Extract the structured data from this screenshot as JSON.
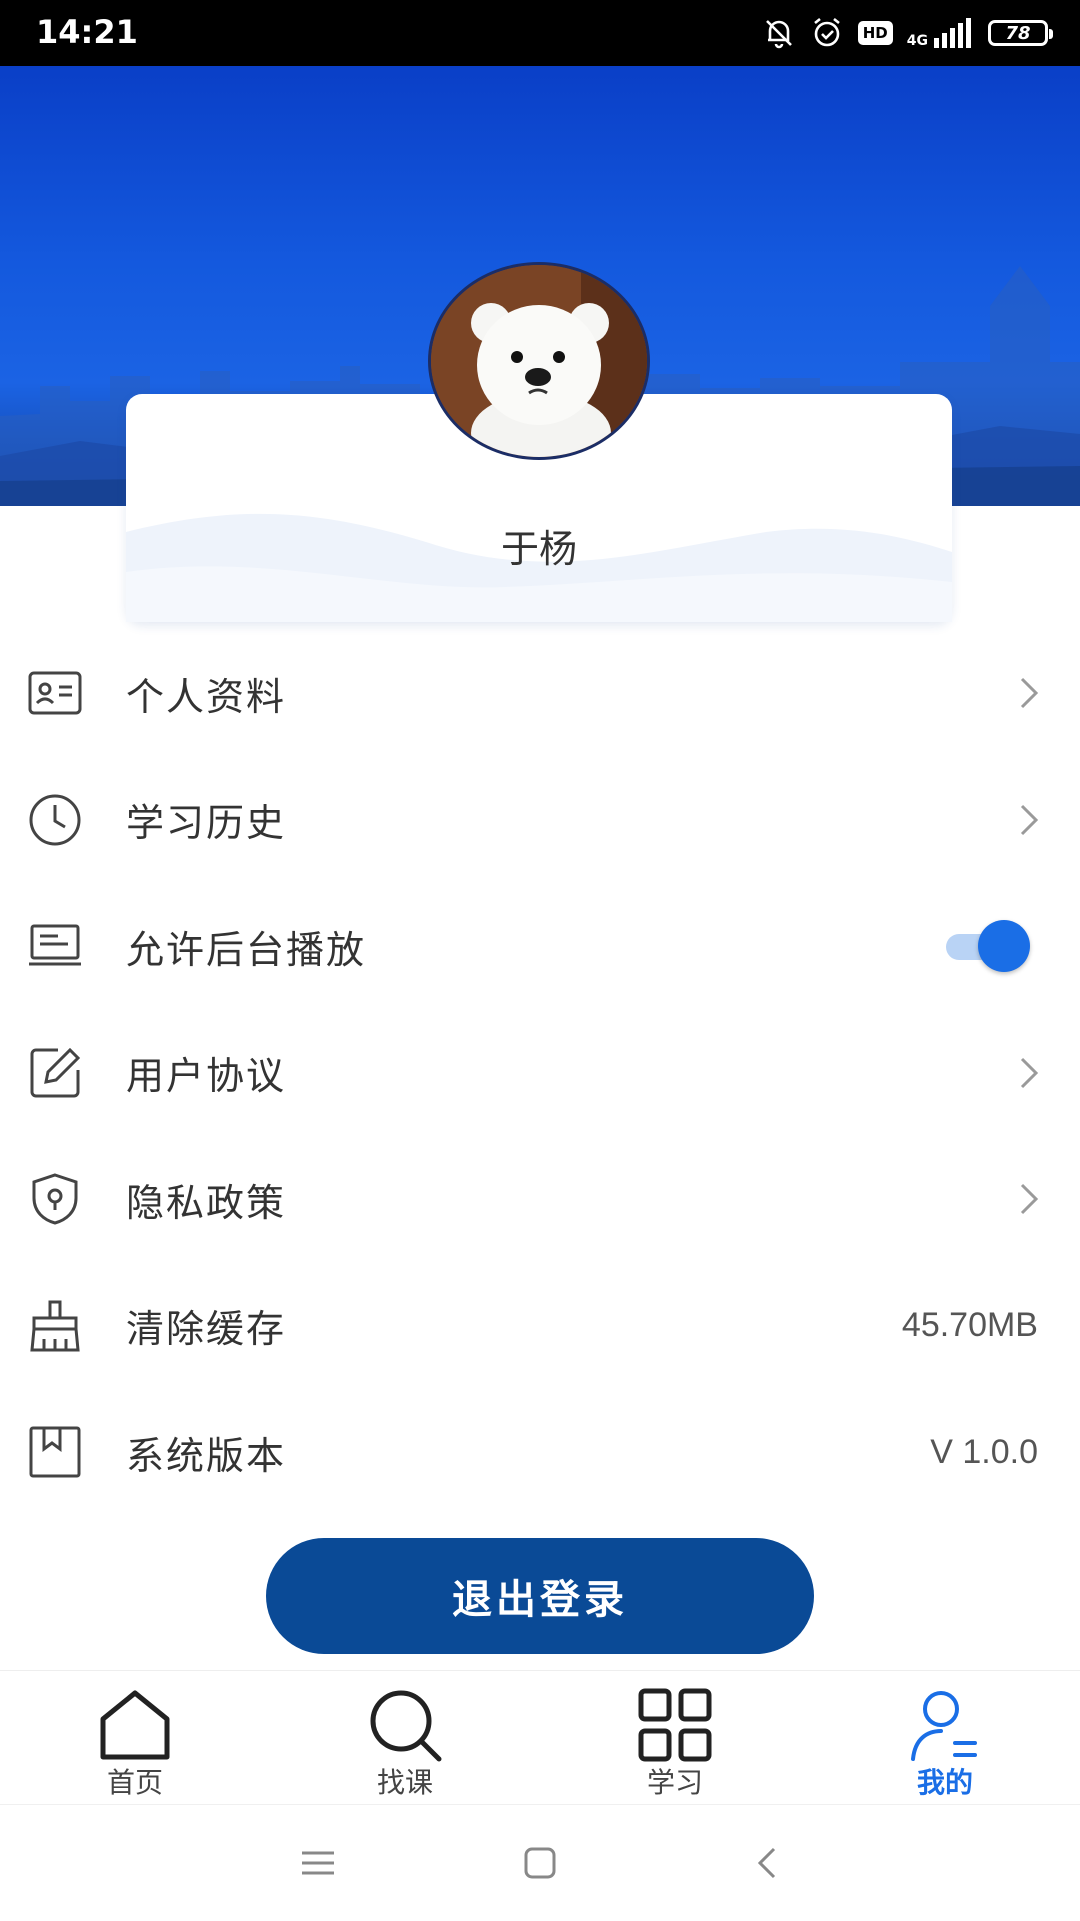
{
  "status_bar": {
    "time": "14:21",
    "network": "4G",
    "hd_label": "HD",
    "battery": "78",
    "icons": [
      "bell-off-icon",
      "alarm-icon",
      "hd-icon",
      "signal-icon",
      "battery-icon"
    ]
  },
  "profile": {
    "name": "于杨",
    "avatar": "avatar-photo"
  },
  "menu": {
    "items": [
      {
        "label": "个人资料",
        "icon": "id-card-icon",
        "accessory": "chevron"
      },
      {
        "label": "学习历史",
        "icon": "clock-icon",
        "accessory": "chevron"
      },
      {
        "label": "允许后台播放",
        "icon": "laptop-icon",
        "accessory": "toggle",
        "toggle_on": true
      },
      {
        "label": "用户协议",
        "icon": "edit-icon",
        "accessory": "chevron"
      },
      {
        "label": "隐私政策",
        "icon": "shield-lock-icon",
        "accessory": "chevron"
      },
      {
        "label": "清除缓存",
        "icon": "broom-icon",
        "accessory": "value",
        "value": "45.70MB"
      },
      {
        "label": "系统版本",
        "icon": "bookmark-icon",
        "accessory": "value",
        "value": "V 1.0.0"
      }
    ]
  },
  "logout": {
    "label": "退出登录"
  },
  "bottom_nav": {
    "items": [
      {
        "label": "首页",
        "icon": "home-icon",
        "active": false
      },
      {
        "label": "找课",
        "icon": "search-icon",
        "active": false
      },
      {
        "label": "学习",
        "icon": "grid-icon",
        "active": false
      },
      {
        "label": "我的",
        "icon": "user-icon",
        "active": true
      }
    ]
  },
  "colors": {
    "banner_blue": "#1459de",
    "accent": "#1a6ee6",
    "logout_button": "#0a4a96",
    "text": "#333333"
  }
}
